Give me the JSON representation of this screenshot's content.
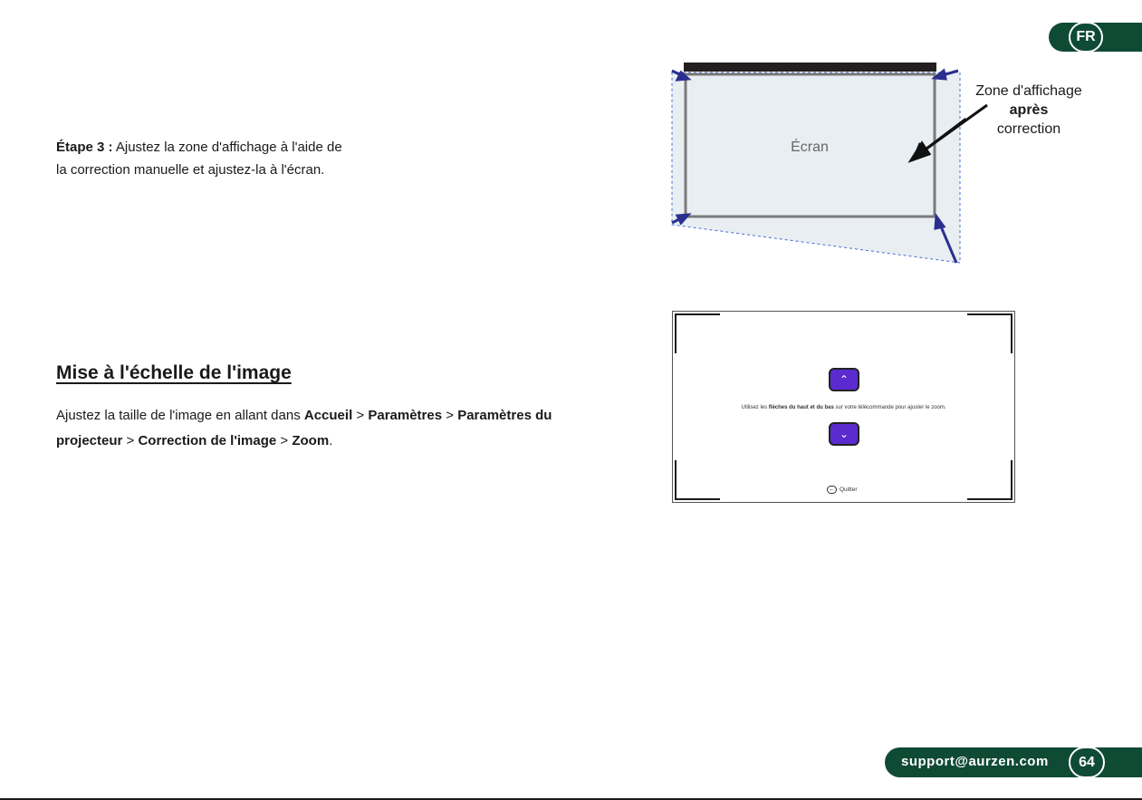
{
  "header": {
    "lang": "FR"
  },
  "step": {
    "label": "Étape 3 :",
    "text_1": " Ajustez la zone d'affichage à l'aide de",
    "text_2": "la correction manuelle et ajustez-la à l'écran."
  },
  "diagram": {
    "screen_label": "Écran",
    "zone_line1": "Zone d'affichage",
    "zone_line2": "après",
    "zone_line3": "correction"
  },
  "section": {
    "title": "Mise à l'échelle de l'image",
    "p1": "Ajustez la taille de l'image en allant dans ",
    "b1": "Accueil",
    "sep1": " > ",
    "b2": "Paramètres",
    "sep2": " > ",
    "b3": "Paramètres du",
    "b4": "projecteur",
    "sep3": " > ",
    "b5": "Correction de l'image",
    "sep4": " > ",
    "b6": "Zoom",
    "end": "."
  },
  "zoom_screen": {
    "up_icon": "chevron-up-icon",
    "down_icon": "chevron-down-icon",
    "instr_pre": "Utilisez les ",
    "instr_bold": "flèches du haut et du bas",
    "instr_post": " sur votre télécommande pour ajuster le zoom.",
    "quit": "Quitter"
  },
  "footer": {
    "email": "support@aurzen.com",
    "page": "64"
  },
  "colors": {
    "brand_green": "#0f4a35",
    "arrow_blue": "#2b2f8f",
    "button_purple": "#5b2bd0",
    "screen_fill": "#e8eef2"
  }
}
